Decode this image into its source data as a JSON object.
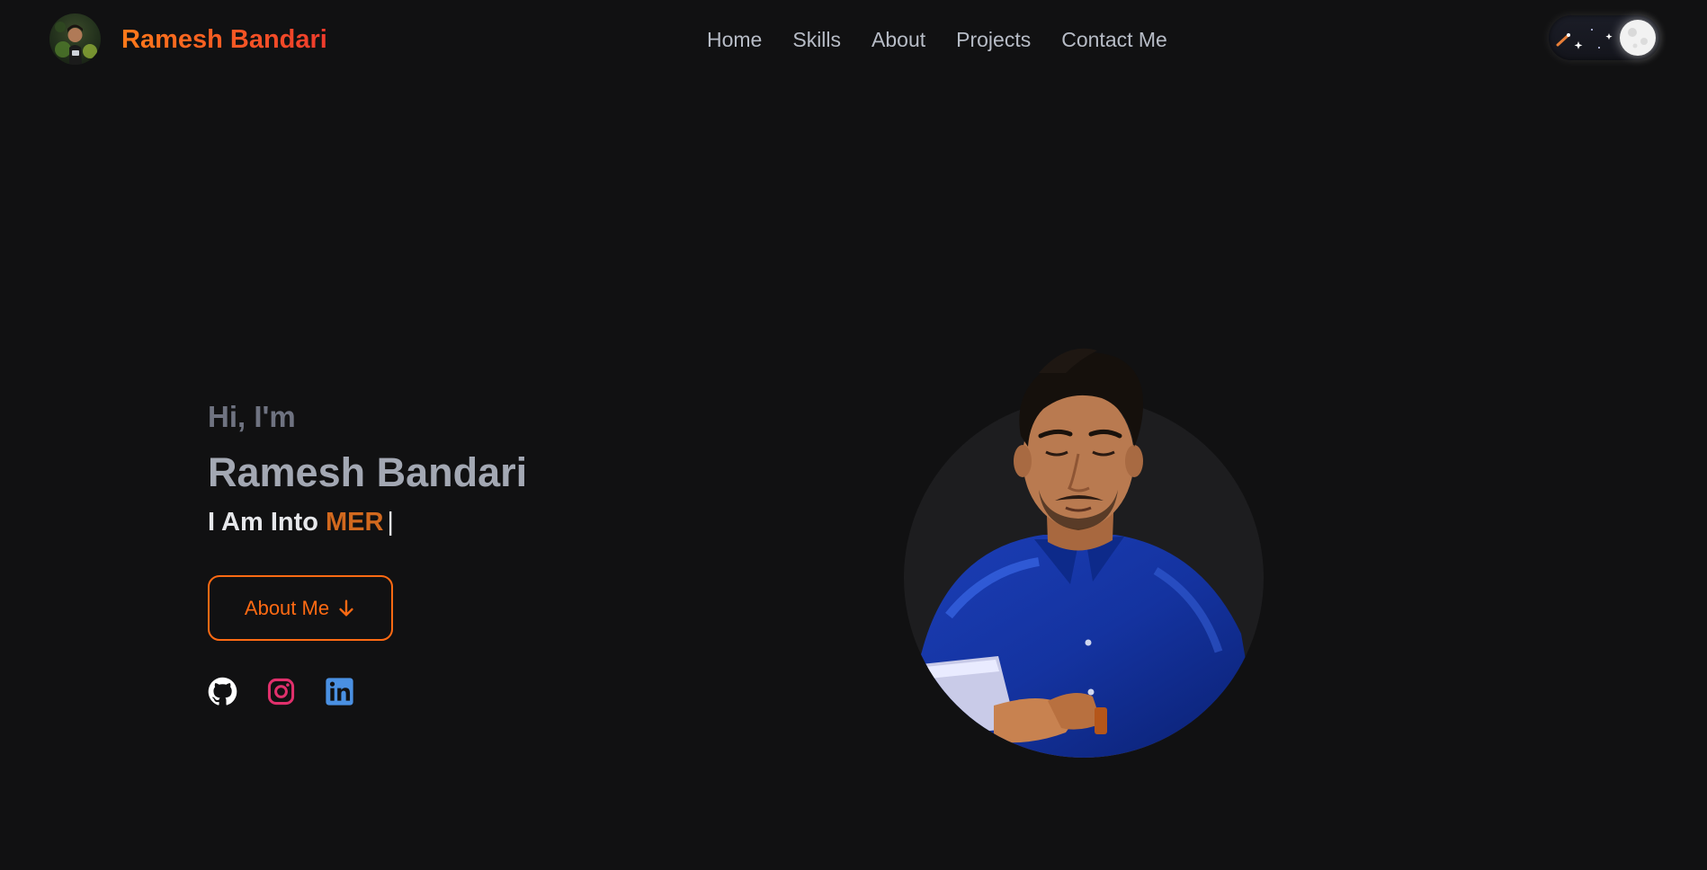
{
  "brand": {
    "name": "Ramesh Bandari",
    "avatar_icon": "profile-photo"
  },
  "nav": {
    "items": [
      {
        "label": "Home"
      },
      {
        "label": "Skills"
      },
      {
        "label": "About"
      },
      {
        "label": "Projects"
      },
      {
        "label": "Contact Me"
      }
    ]
  },
  "theme_toggle": {
    "state": "dark",
    "icon": "moon-icon"
  },
  "hero": {
    "greeting": "Hi, I'm",
    "name": "Ramesh Bandari",
    "typing_prefix": "I Am Into",
    "typing_word": "MER",
    "typing_cursor": "|",
    "about_button": "About Me",
    "socials": [
      {
        "name": "github-icon"
      },
      {
        "name": "instagram-icon"
      },
      {
        "name": "linkedin-icon"
      }
    ]
  },
  "colors": {
    "background": "#111112",
    "accent": "#ff6a13",
    "brand_gradient_start": "#ff7a1a",
    "brand_gradient_end": "#ef3b2c",
    "nav_text": "#b7bcc6",
    "typing_word": "#d2691e",
    "instagram": "#e1306c",
    "linkedin": "#4a90e2"
  }
}
